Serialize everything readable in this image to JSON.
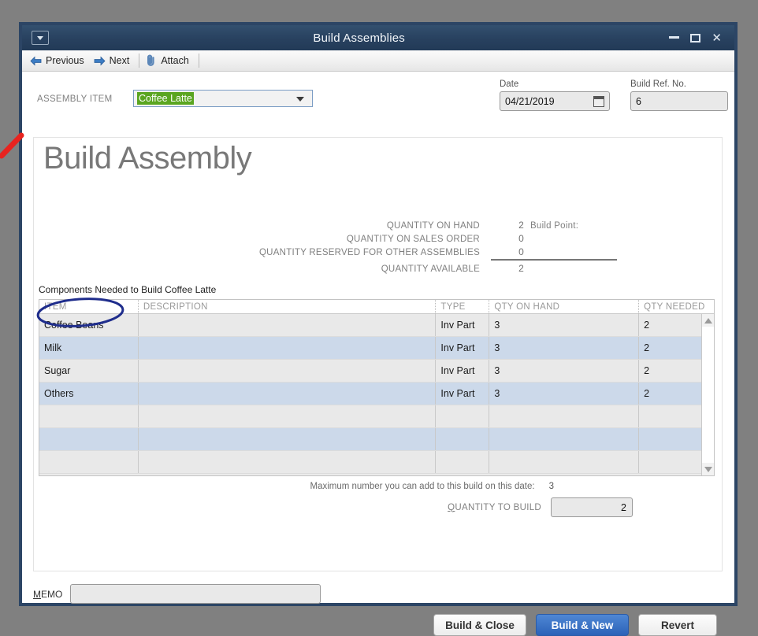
{
  "window": {
    "title": "Build Assemblies",
    "system_menu_icon": "window-menu-icon",
    "controls": {
      "minimize": "minimize-icon",
      "maximize": "maximize-icon",
      "close": "✕"
    }
  },
  "toolbar": {
    "previous_label": "Previous",
    "next_label": "Next",
    "attach_label": "Attach"
  },
  "form": {
    "assembly_item_label": "ASSEMBLY ITEM",
    "assembly_item_value": "Coffee Latte",
    "date_label": "Date",
    "date_value": "04/21/2019",
    "build_ref_label": "Build Ref. No.",
    "build_ref_value": "6"
  },
  "panel": {
    "heading": "Build Assembly",
    "summary": [
      {
        "label": "QUANTITY ON HAND",
        "value": "2",
        "extra": "Build Point:"
      },
      {
        "label": "QUANTITY ON SALES ORDER",
        "value": "0",
        "extra": ""
      },
      {
        "label": "QUANTITY RESERVED FOR OTHER ASSEMBLIES",
        "value": "0",
        "extra": ""
      },
      {
        "label": "QUANTITY AVAILABLE",
        "value": "2",
        "extra": ""
      }
    ],
    "components_caption": "Components Needed to Build  Coffee Latte",
    "table": {
      "headers": [
        "ITEM",
        "DESCRIPTION",
        "TYPE",
        "QTY ON HAND",
        "QTY NEEDED"
      ],
      "rows": [
        {
          "item": "Coffee Beans",
          "description": "",
          "type": "Inv Part",
          "qty_on_hand": "3",
          "qty_needed": "2"
        },
        {
          "item": "Milk",
          "description": "",
          "type": "Inv Part",
          "qty_on_hand": "3",
          "qty_needed": "2"
        },
        {
          "item": "Sugar",
          "description": "",
          "type": "Inv Part",
          "qty_on_hand": "3",
          "qty_needed": "2"
        },
        {
          "item": "Others",
          "description": "",
          "type": "Inv Part",
          "qty_on_hand": "3",
          "qty_needed": "2"
        },
        {
          "item": "",
          "description": "",
          "type": "",
          "qty_on_hand": "",
          "qty_needed": ""
        },
        {
          "item": "",
          "description": "",
          "type": "",
          "qty_on_hand": "",
          "qty_needed": ""
        },
        {
          "item": "",
          "description": "",
          "type": "",
          "qty_on_hand": "",
          "qty_needed": ""
        }
      ]
    },
    "max_note_label": "Maximum number you can add to this build on this date:",
    "max_note_value": "3",
    "quantity_to_build_label": "QUANTITY TO BUILD",
    "quantity_to_build_value": "2"
  },
  "footer": {
    "memo_label": "MEMO",
    "memo_value": "",
    "build_close_label": "Build & Close",
    "build_new_label": "Build & New",
    "revert_label": "Revert"
  },
  "annotations": {
    "oval_target": "Coffee Beans",
    "oval_color": "#1f2d8c",
    "arrow_color": "#e8231f"
  },
  "colors": {
    "titlebar": "#27405f",
    "desktop": "#808080",
    "primary_button": "#2b62b8",
    "selection_green": "#5aa520",
    "row_alt": "#ccd9ea"
  }
}
